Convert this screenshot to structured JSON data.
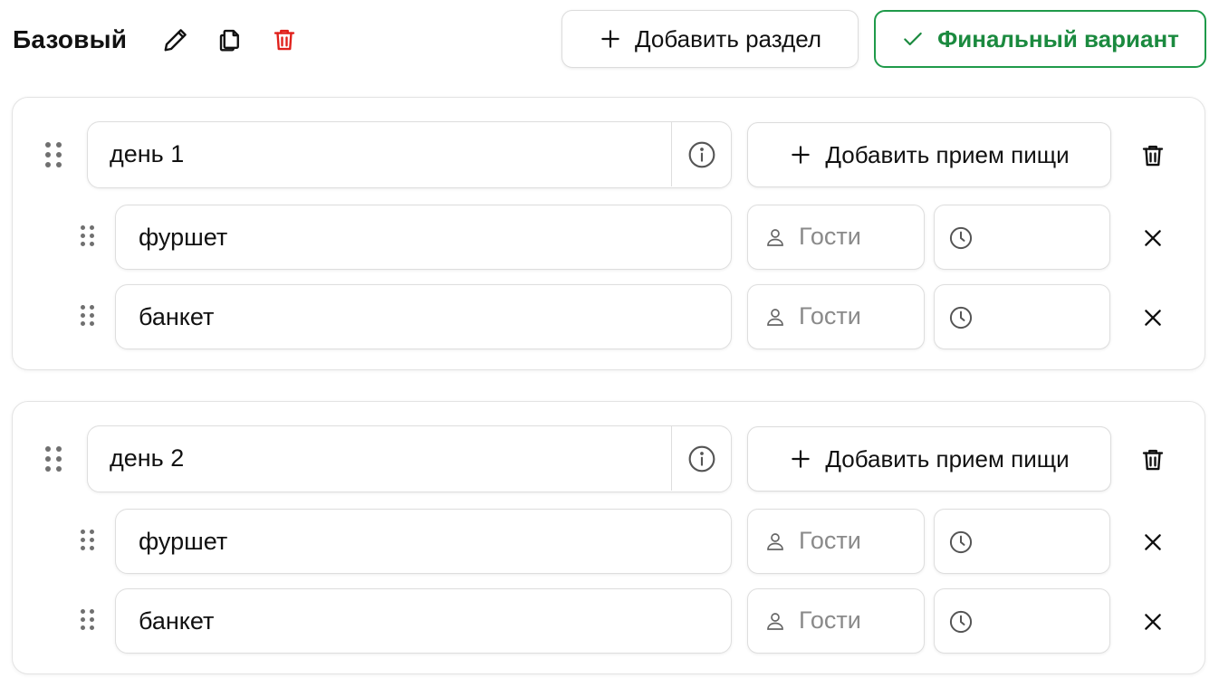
{
  "header": {
    "menu_title": "Базовый",
    "add_section_label": "Добавить раздел",
    "final_variant_label": "Финальный вариант"
  },
  "icons": {
    "edit": "pencil-icon",
    "copy": "copy-icon",
    "delete": "trash-icon",
    "add": "plus-icon",
    "confirm": "check-icon",
    "info": "info-icon",
    "guests": "user-icon",
    "time": "clock-icon",
    "remove": "close-icon",
    "drag": "drag-handle-icon"
  },
  "colors": {
    "accent_green": "#1b8a3f",
    "danger_red": "#e0201b",
    "border": "#dedede"
  },
  "sections": [
    {
      "day_value": "день 1",
      "add_meal_label": "Добавить прием пищи",
      "meals": [
        {
          "name": "фуршет",
          "guests_value": "",
          "guests_placeholder": "Гости",
          "time_value": ""
        },
        {
          "name": "банкет",
          "guests_value": "",
          "guests_placeholder": "Гости",
          "time_value": ""
        }
      ]
    },
    {
      "day_value": "день 2",
      "add_meal_label": "Добавить прием пищи",
      "meals": [
        {
          "name": "фуршет",
          "guests_value": "",
          "guests_placeholder": "Гости",
          "time_value": ""
        },
        {
          "name": "банкет",
          "guests_value": "",
          "guests_placeholder": "Гости",
          "time_value": ""
        }
      ]
    }
  ]
}
